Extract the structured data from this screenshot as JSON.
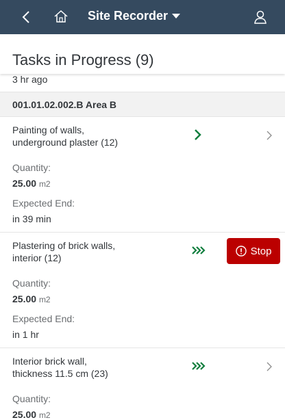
{
  "app": {
    "title": "Site Recorder"
  },
  "page": {
    "title": "Tasks in Progress (9)",
    "partial_item_time": "3 hr ago"
  },
  "group": {
    "title": "001.01.02.002.B Area B"
  },
  "tasks": [
    {
      "title_line1": "Painting of walls,",
      "title_line2": "underground plaster (12)",
      "quantity_label": "Quantity:",
      "quantity_value": "25.00",
      "quantity_unit": "m2",
      "end_label": "Expected End:",
      "end_value": "in 39 min",
      "status_icon": "chevron-right-icon",
      "status_color": "#107e3e"
    },
    {
      "title_line1": "Plastering of brick walls,",
      "title_line2": "interior (12)",
      "quantity_label": "Quantity:",
      "quantity_value": "25.00",
      "quantity_unit": "m2",
      "end_label": "Expected End:",
      "end_value": "in 1 hr",
      "status_icon": "triple-chevron-right-icon",
      "status_color": "#107e3e",
      "action_label": "Stop",
      "action_color": "#bb0000"
    },
    {
      "title_line1": "Interior brick wall,",
      "title_line2": "thickness 11.5 cm (23)",
      "quantity_label": "Quantity:",
      "quantity_value": "25.00",
      "quantity_unit": "m2",
      "status_icon": "triple-chevron-right-icon",
      "status_color": "#107e3e"
    }
  ],
  "colors": {
    "shellbar": "#354a5f",
    "success": "#107e3e",
    "negative": "#bb0000"
  }
}
